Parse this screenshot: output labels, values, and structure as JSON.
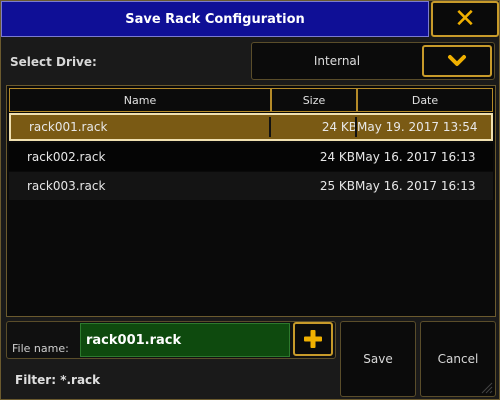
{
  "dialog": {
    "title": "Save Rack Configuration",
    "close_icon": "close-icon"
  },
  "drive": {
    "label": "Select Drive:",
    "value": "Internal",
    "dropdown_icon": "chevron-down-icon"
  },
  "table": {
    "columns": [
      "Name",
      "Size",
      "Date"
    ],
    "rows": [
      {
        "name": "rack001.rack",
        "size": "24 KB",
        "date": "May 19. 2017 13:54",
        "selected": true
      },
      {
        "name": "rack002.rack",
        "size": "24 KB",
        "date": "May 16. 2017 16:13",
        "selected": false
      },
      {
        "name": "rack003.rack",
        "size": "25 KB",
        "date": "May 16. 2017 16:13",
        "selected": false
      }
    ]
  },
  "file": {
    "label": "File name:",
    "value": "rack001.rack",
    "add_icon": "plus-icon"
  },
  "filter": "Filter: *.rack",
  "buttons": {
    "save": "Save",
    "cancel": "Cancel"
  },
  "colors": {
    "title_bar": "#0f0f96",
    "accent": "#f0b000",
    "selection": "#7a5a14",
    "input_bg": "#0e4a0e"
  }
}
